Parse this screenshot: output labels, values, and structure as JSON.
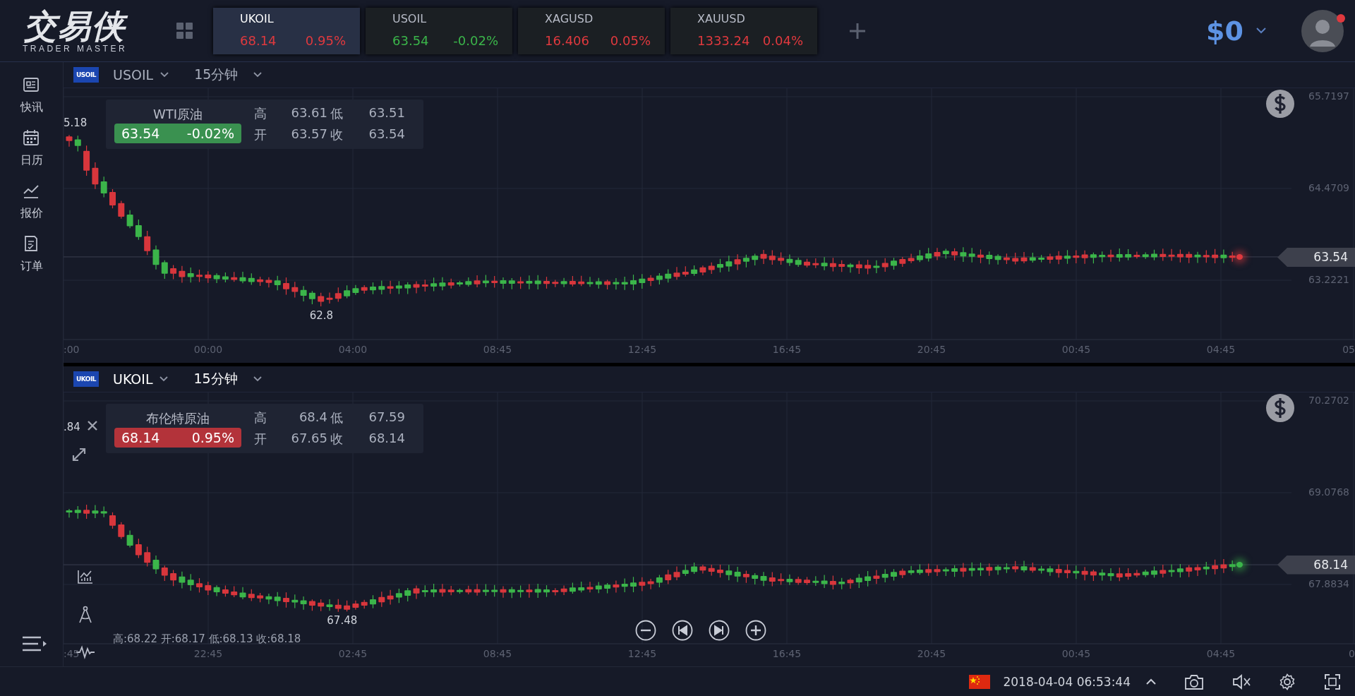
{
  "header": {
    "logo": {
      "title": "交易侠",
      "subtitle": "TRADER MASTER"
    },
    "tickers": [
      {
        "symbol": "UKOIL",
        "price": "68.14",
        "change": "0.95%",
        "rising": true,
        "selected": true
      },
      {
        "symbol": "USOIL",
        "price": "63.54",
        "change": "-0.02%",
        "rising": false,
        "selected": false
      },
      {
        "symbol": "XAGUSD",
        "price": "16.406",
        "change": "0.05%",
        "rising": true,
        "selected": false
      },
      {
        "symbol": "XAUUSD",
        "price": "1333.24",
        "change": "0.04%",
        "rising": true,
        "selected": false
      }
    ],
    "balance": "$0",
    "notification": true
  },
  "sidebar": {
    "items": [
      {
        "label": "快讯",
        "kind": "news"
      },
      {
        "label": "日历",
        "kind": "calendar"
      },
      {
        "label": "报价",
        "kind": "quotes"
      },
      {
        "label": "订单",
        "kind": "orders"
      }
    ]
  },
  "charts": [
    {
      "badge": "USOIL",
      "symbol": "USOIL",
      "timeframe": "15分钟",
      "active": false,
      "name": "WTI原油",
      "price": "63.54",
      "change": "-0.02%",
      "rising": false,
      "stats": [
        {
          "label": "高",
          "value": "63.61"
        },
        {
          "label": "低",
          "value": "63.51"
        },
        {
          "label": "开",
          "value": "63.57"
        },
        {
          "label": "收",
          "value": "63.54"
        }
      ],
      "edge_label": "5.18",
      "low_label": "62.8",
      "y_labels": [
        "65.7197",
        "64.4709",
        "63.2221"
      ],
      "last_price": "63.54",
      "last_candle_rising": true,
      "x_labels": [
        ":00",
        "00:00",
        "04:00",
        "08:45",
        "12:45",
        "16:45",
        "20:45",
        "00:45",
        "04:45",
        "05"
      ]
    },
    {
      "badge": "UKOIL",
      "symbol": "UKOIL",
      "timeframe": "15分钟",
      "active": true,
      "name": "布伦特原油",
      "price": "68.14",
      "change": "0.95%",
      "rising": true,
      "stats": [
        {
          "label": "高",
          "value": "68.4"
        },
        {
          "label": "低",
          "value": "67.59"
        },
        {
          "label": "开",
          "value": "67.65"
        },
        {
          "label": "收",
          "value": "68.14"
        }
      ],
      "edge_label": ".84",
      "low_label": "67.48",
      "y_labels": [
        "70.2702",
        "69.0768",
        "67.8834"
      ],
      "last_price": "68.14",
      "last_candle_rising": false,
      "ohlc": "高:68.22 开:68.17 低:68.13 收:68.18",
      "x_labels": [
        ":45",
        "22:45",
        "02:45",
        "08:45",
        "12:45",
        "16:45",
        "20:45",
        "00:45",
        "04:45",
        "0"
      ]
    }
  ],
  "footer": {
    "datetime": "2018-04-04 06:53:44"
  }
}
